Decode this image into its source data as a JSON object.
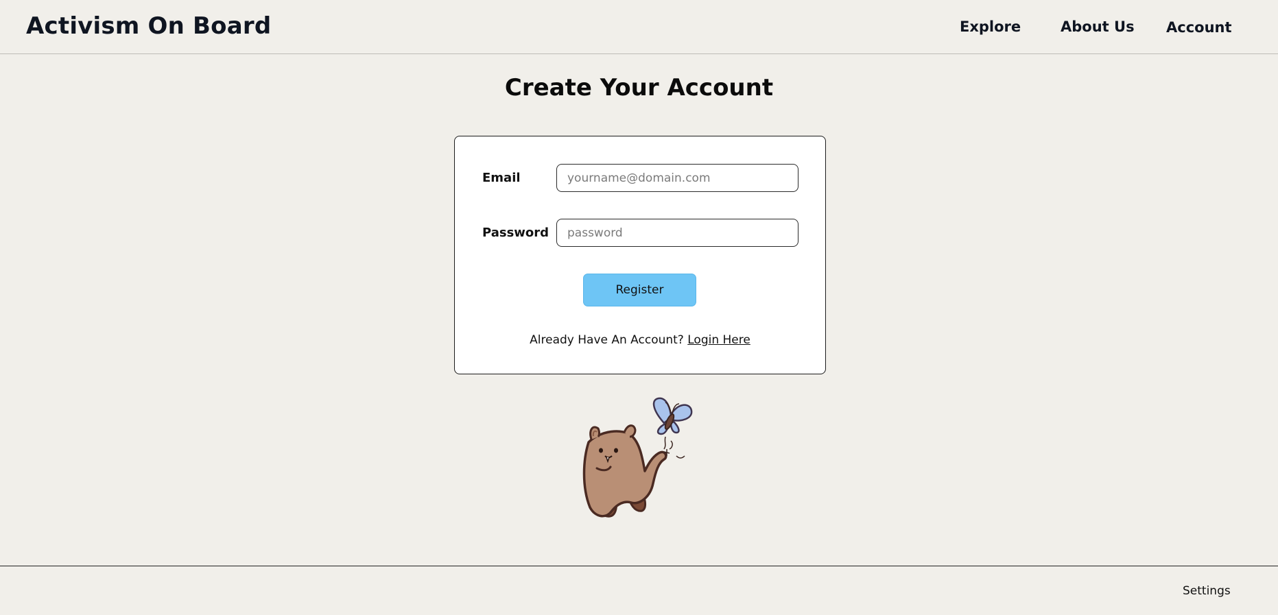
{
  "header": {
    "brand": "Activism On Board",
    "nav": {
      "explore": "Explore",
      "about": "About Us",
      "account": "Account"
    }
  },
  "page": {
    "title": "Create Your Account"
  },
  "form": {
    "email_label": "Email",
    "email_placeholder": "yourname@domain.com",
    "email_value": "",
    "password_label": "Password",
    "password_placeholder": "password",
    "password_value": "",
    "register_label": "Register",
    "already_text": "Already Have An Account?",
    "login_link": "Login Here"
  },
  "illustration": {
    "subject": "cartoon-bear-with-butterfly"
  },
  "footer": {
    "settings": "Settings"
  },
  "colors": {
    "background": "#f1efea",
    "card": "#ffffff",
    "register_button": "#6ec5f5",
    "text": "#0f1521"
  }
}
